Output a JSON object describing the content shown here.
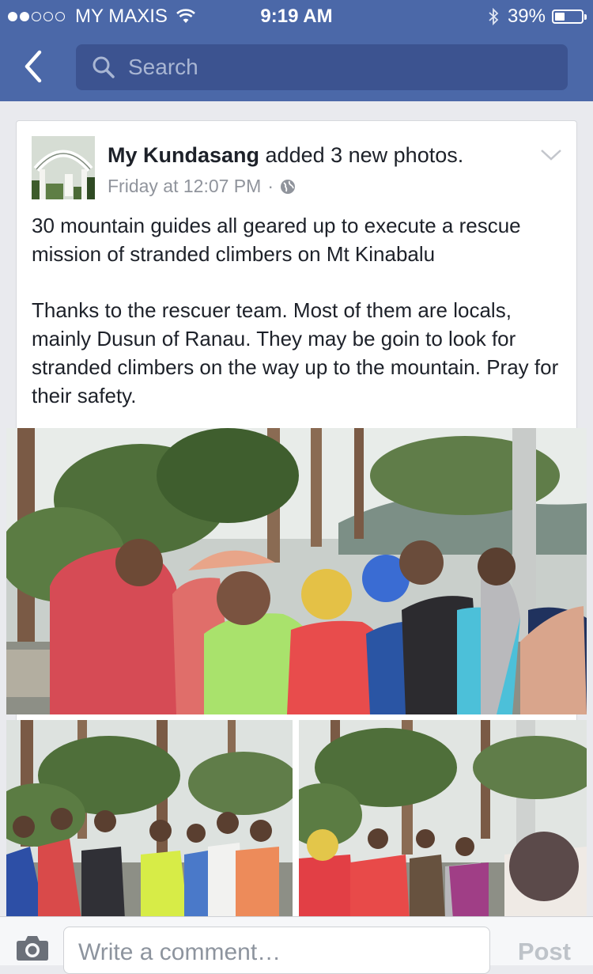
{
  "status_bar": {
    "carrier": "MY MAXIS",
    "time": "9:19 AM",
    "battery": "39%",
    "battery_level": 0.39,
    "signal_bars": 2,
    "signal_total": 5
  },
  "nav": {
    "back_icon": "chevron-left-icon",
    "search_placeholder": "Search"
  },
  "post": {
    "author": "My Kundasang",
    "action": " added 3 new photos.",
    "timestamp": "Friday at 12:07 PM",
    "separator": "·",
    "privacy_icon": "globe-icon",
    "paragraphs": [
      "30 mountain guides all geared up to execute a rescue mission of stranded climbers on Mt Kinabalu",
      "Thanks to the rescuer team. Most of them are locals, mainly Dusun of Ranau. They may be goin to look for stranded climbers on the way up to the mountain. Pray for their safety."
    ]
  },
  "comment_bar": {
    "placeholder": "Write a comment…",
    "post_label": "Post",
    "camera_icon": "camera-icon"
  },
  "colors": {
    "header_blue": "#4b68a8",
    "search_bg": "#3c5390",
    "text_dark": "#1d2129",
    "text_meta": "#90949c"
  }
}
